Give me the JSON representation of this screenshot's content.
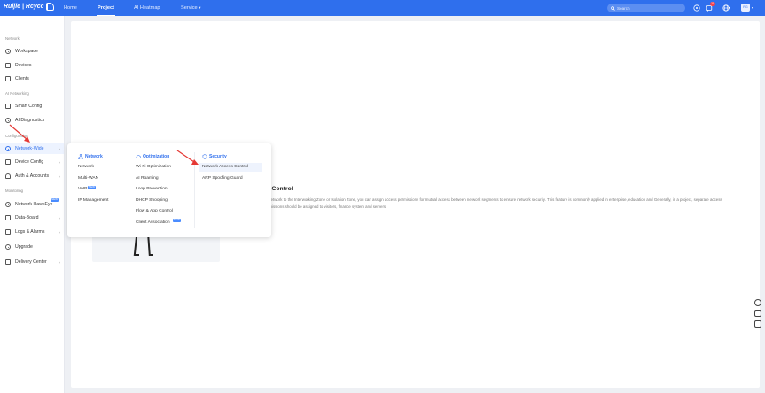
{
  "header": {
    "logo_text": "Ruijie | Rcycc",
    "nav": [
      {
        "label": "Home"
      },
      {
        "label": "Project"
      },
      {
        "label": "AI Heatmap"
      },
      {
        "label": "Service"
      }
    ],
    "search_placeholder": "Search",
    "notification_count": "10",
    "avatar_text": "RG"
  },
  "sidebar": {
    "sections": {
      "network": "Network",
      "ai_networking": "AI Networking",
      "configuration": "Configuration",
      "monitoring": "Monitoring"
    },
    "items": {
      "workspace": "Workspace",
      "devices": "Devices",
      "clients": "Clients",
      "smart_config": "Smart Config",
      "ai_diagnostics": "AI Diagnostics",
      "network_wide": "Network-Wide",
      "device_config": "Device Config",
      "auth_accounts": "Auth & Accounts",
      "network_hawkeye": "Network HawkEye",
      "data_board": "Data-Board",
      "logs_alarms": "Logs & Alarms",
      "upgrade": "Upgrade",
      "delivery_center": "Delivery Center"
    },
    "new_tag": "NEW"
  },
  "flyout": {
    "columns": [
      {
        "heading": "Network",
        "items": [
          "Network",
          "Multi-WAN",
          "VoIP",
          "IP Management"
        ]
      },
      {
        "heading": "Optimization",
        "items": [
          "Wi-Fi Optimization",
          "AI Roaming",
          "Loop Prevention",
          "DHCP Snooping",
          "Flow & App Control",
          "Client Association"
        ]
      },
      {
        "heading": "Security",
        "items": [
          "Network Access Control",
          "ARP Spoofing Guard"
        ]
      }
    ],
    "new_tag": "NEW"
  },
  "content": {
    "title": "ss Control",
    "description": "ge network to the Interworking Zone or Isolation Zone, you can assign access permissions for mutual access between network segments to ensure network security. This feature is commonly applied in enterprise, education and Generally, in a project, separate access permissions should be assigned to visitors, finance system and servers."
  },
  "colors": {
    "brand": "#2f6fed",
    "annotation_arrow": "#e53935"
  },
  "icons": {
    "search": "search-icon",
    "help": "help-icon",
    "notifications": "bell-icon",
    "language": "globe-icon"
  }
}
